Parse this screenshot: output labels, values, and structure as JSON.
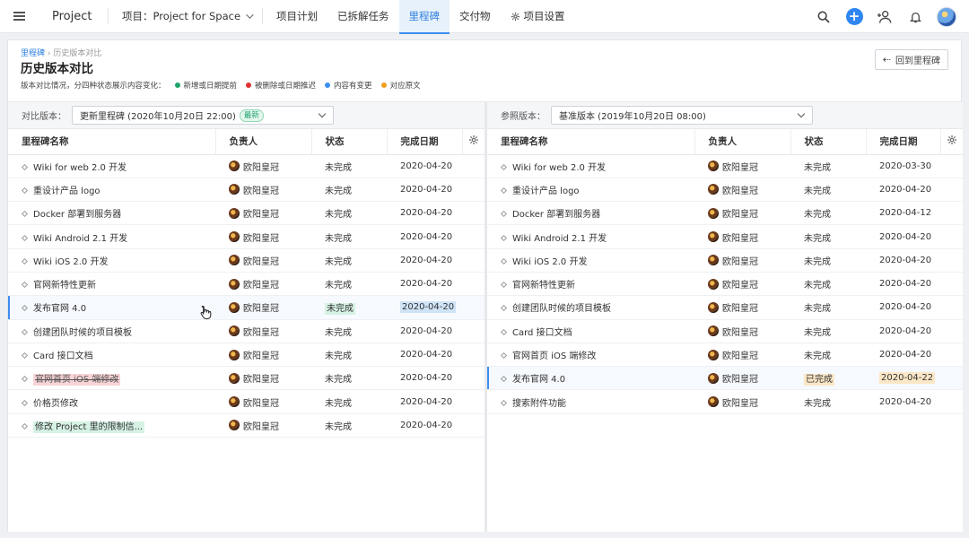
{
  "app": {
    "name": "Project"
  },
  "project": {
    "label": "项目：Project for Space"
  },
  "tabs": [
    {
      "label": "项目计划"
    },
    {
      "label": "已拆解任务"
    },
    {
      "label": "里程碑"
    },
    {
      "label": "交付物"
    },
    {
      "label": "项目设置"
    }
  ],
  "page": {
    "breadcrumb_root": "里程碑",
    "breadcrumb_current": "历史版本对比",
    "title": "历史版本对比",
    "legend_intro": "版本对比情况，分四种状态展示内容变化：",
    "legend": [
      {
        "label": "新增或日期提前",
        "color": "#20a36b"
      },
      {
        "label": "被删除或日期推迟",
        "color": "#e0312f"
      },
      {
        "label": "内容有变更",
        "color": "#3e8ef0"
      },
      {
        "label": "对应原文",
        "color": "#f0a020"
      }
    ],
    "back_button": "回到里程碑"
  },
  "left": {
    "version_label": "对比版本：",
    "version_value": "更新里程碑 (2020年10月20日 22:00)",
    "version_badge": "最新",
    "columns": [
      "里程碑名称",
      "负责人",
      "状态",
      "完成日期"
    ],
    "rows": [
      {
        "name": "Wiki for web 2.0 开发",
        "owner": "欧阳皇冠",
        "status": "未完成",
        "date": "2020-04-20"
      },
      {
        "name": "重设计产品 logo",
        "owner": "欧阳皇冠",
        "status": "未完成",
        "date": "2020-04-20"
      },
      {
        "name": "Docker 部署到服务器",
        "owner": "欧阳皇冠",
        "status": "未完成",
        "date": "2020-04-20"
      },
      {
        "name": "Wiki Android 2.1 开发",
        "owner": "欧阳皇冠",
        "status": "未完成",
        "date": "2020-04-20"
      },
      {
        "name": "Wiki iOS 2.0 开发",
        "owner": "欧阳皇冠",
        "status": "未完成",
        "date": "2020-04-20"
      },
      {
        "name": "官网新特性更新",
        "owner": "欧阳皇冠",
        "status": "未完成",
        "date": "2020-04-20"
      },
      {
        "name": "发布官网 4.0",
        "owner": "欧阳皇冠",
        "status": "未完成",
        "date": "2020-04-20"
      },
      {
        "name": "创建团队时候的项目模板",
        "owner": "欧阳皇冠",
        "status": "未完成",
        "date": "2020-04-20"
      },
      {
        "name": "Card 接口文档",
        "owner": "欧阳皇冠",
        "status": "未完成",
        "date": "2020-04-20"
      },
      {
        "name": "官网首页 iOS 端修改",
        "owner": "欧阳皇冠",
        "status": "未完成",
        "date": "2020-04-20"
      },
      {
        "name": "价格页修改",
        "owner": "欧阳皇冠",
        "status": "未完成",
        "date": "2020-04-20"
      },
      {
        "name": "修改 Project 里的限制信...",
        "owner": "欧阳皇冠",
        "status": "未完成",
        "date": "2020-04-20"
      }
    ]
  },
  "right": {
    "version_label": "参照版本：",
    "version_value": "基准版本 (2019年10月20日 08:00)",
    "columns": [
      "里程碑名称",
      "负责人",
      "状态",
      "完成日期"
    ],
    "rows": [
      {
        "name": "Wiki for web 2.0 开发",
        "owner": "欧阳皇冠",
        "status": "未完成",
        "date": "2020-03-30"
      },
      {
        "name": "重设计产品 logo",
        "owner": "欧阳皇冠",
        "status": "未完成",
        "date": "2020-04-20"
      },
      {
        "name": "Docker 部署到服务器",
        "owner": "欧阳皇冠",
        "status": "未完成",
        "date": "2020-04-12"
      },
      {
        "name": "Wiki Android 2.1 开发",
        "owner": "欧阳皇冠",
        "status": "未完成",
        "date": "2020-04-20"
      },
      {
        "name": "Wiki iOS 2.0 开发",
        "owner": "欧阳皇冠",
        "status": "未完成",
        "date": "2020-04-20"
      },
      {
        "name": "官网新特性更新",
        "owner": "欧阳皇冠",
        "status": "未完成",
        "date": "2020-04-20"
      },
      {
        "name": "创建团队时候的项目模板",
        "owner": "欧阳皇冠",
        "status": "未完成",
        "date": "2020-04-20"
      },
      {
        "name": "Card 接口文档",
        "owner": "欧阳皇冠",
        "status": "未完成",
        "date": "2020-04-20"
      },
      {
        "name": "官网首页 iOS 端修改",
        "owner": "欧阳皇冠",
        "status": "未完成",
        "date": "2020-04-20"
      },
      {
        "name": "发布官网 4.0",
        "owner": "欧阳皇冠",
        "status": "已完成",
        "date": "2020-04-22"
      },
      {
        "name": "搜索附件功能",
        "owner": "欧阳皇冠",
        "status": "未完成",
        "date": "2020-04-20"
      }
    ]
  }
}
